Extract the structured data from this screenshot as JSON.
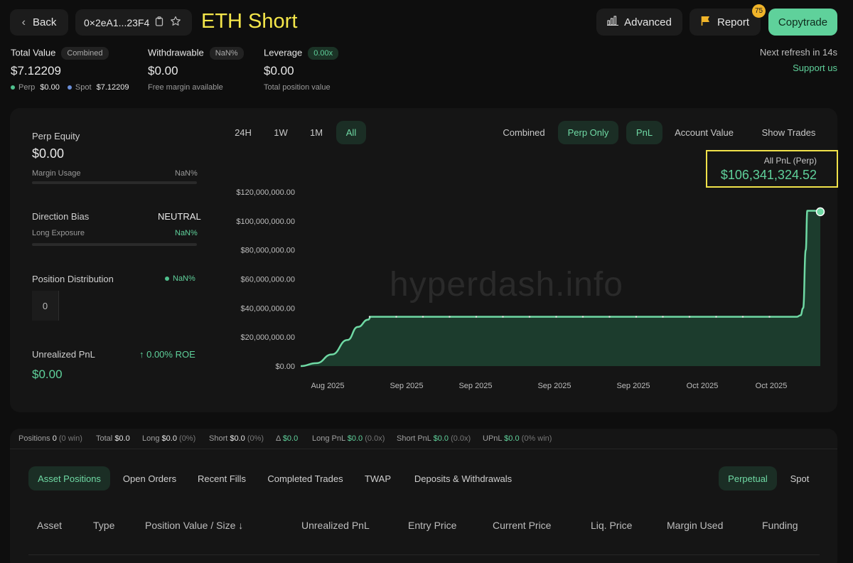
{
  "header": {
    "back_label": "Back",
    "address": "0×2eA1...23F4",
    "title": "ETH Short",
    "advanced_label": "Advanced",
    "report_label": "Report",
    "report_badge": "75",
    "copytrade_label": "Copytrade"
  },
  "summary": {
    "total_value_label": "Total Value",
    "combined_badge": "Combined",
    "total_value": "$7.12209",
    "perp_label": "Perp",
    "perp_value": "$0.00",
    "spot_label": "Spot",
    "spot_value": "$7.12209",
    "withdrawable_label": "Withdrawable",
    "withdrawable_badge": "NaN%",
    "withdrawable_value": "$0.00",
    "withdrawable_sub": "Free margin available",
    "leverage_label": "Leverage",
    "leverage_badge": "0.00x",
    "leverage_value": "$0.00",
    "leverage_sub": "Total position value",
    "refresh_text": "Next refresh in 14s",
    "support_label": "Support us"
  },
  "left_panel": {
    "perp_equity_label": "Perp Equity",
    "perp_equity_value": "$0.00",
    "margin_usage_label": "Margin Usage",
    "margin_usage_value": "NaN%",
    "direction_bias_label": "Direction Bias",
    "direction_bias_value": "NEUTRAL",
    "long_exposure_label": "Long Exposure",
    "long_exposure_value": "NaN%",
    "position_dist_label": "Position Distribution",
    "position_dist_value": "NaN%",
    "position_count": "0",
    "unrealized_label": "Unrealized PnL",
    "roe_text": "↑ 0.00% ROE",
    "unrealized_value": "$0.00"
  },
  "chart_controls": {
    "ranges": [
      "24H",
      "1W",
      "1M",
      "All"
    ],
    "active_range": "All",
    "combined_label": "Combined",
    "perp_only_label": "Perp Only",
    "pnl_label": "PnL",
    "account_value_label": "Account Value",
    "show_trades_label": "Show Trades",
    "pnl_box_label": "All PnL (Perp)",
    "pnl_box_value": "$106,341,324.52",
    "watermark": "hyperdash.info"
  },
  "chart_data": {
    "type": "area",
    "title": "",
    "xlabel": "",
    "ylabel": "",
    "ylim": [
      0,
      120000000
    ],
    "y_ticks": [
      "$0.00",
      "$20,000,000.00",
      "$40,000,000.00",
      "$60,000,000.00",
      "$80,000,000.00",
      "$100,000,000.00",
      "$120,000,000.00"
    ],
    "x_ticks": [
      "Aug 2025",
      "Sep 2025",
      "Sep 2025",
      "Sep 2025",
      "Sep 2025",
      "Oct 2025",
      "Oct 2025"
    ],
    "series": [
      {
        "values": [
          0,
          2000000,
          8000000,
          18000000,
          27000000,
          32000000,
          34000000,
          34000000,
          34000000,
          34000000,
          34000000,
          34000000,
          34000000,
          34000000,
          34000000,
          34000000,
          34000000,
          34000000,
          34000000,
          34000000,
          35000000,
          40000000,
          80000000,
          107000000,
          107000000,
          106341324.52
        ]
      }
    ],
    "line_color": "#6fd9a4",
    "fill_color": "#1f4a35",
    "grid": false
  },
  "stats_bar": {
    "positions_label": "Positions",
    "positions_value": "0",
    "positions_sub": "(0 win)",
    "total_label": "Total",
    "total_value": "$0.0",
    "long_label": "Long",
    "long_value": "$0.0",
    "long_sub": "(0%)",
    "short_label": "Short",
    "short_value": "$0.0",
    "short_sub": "(0%)",
    "delta_label": "Δ",
    "delta_value": "$0.0",
    "long_pnl_label": "Long PnL",
    "long_pnl_value": "$0.0",
    "long_pnl_sub": "(0.0x)",
    "short_pnl_label": "Short PnL",
    "short_pnl_value": "$0.0",
    "short_pnl_sub": "(0.0x)",
    "upnl_label": "UPnL",
    "upnl_value": "$0.0",
    "upnl_sub": "(0% win)"
  },
  "tabs": {
    "items": [
      "Asset Positions",
      "Open Orders",
      "Recent Fills",
      "Completed Trades",
      "TWAP",
      "Deposits & Withdrawals"
    ],
    "active": "Asset Positions",
    "perpetual_label": "Perpetual",
    "spot_label": "Spot"
  },
  "table": {
    "columns": [
      "Asset",
      "Type",
      "Position Value / Size ↓",
      "Unrealized PnL",
      "Entry Price",
      "Current Price",
      "Liq. Price",
      "Margin Used",
      "Funding"
    ]
  }
}
